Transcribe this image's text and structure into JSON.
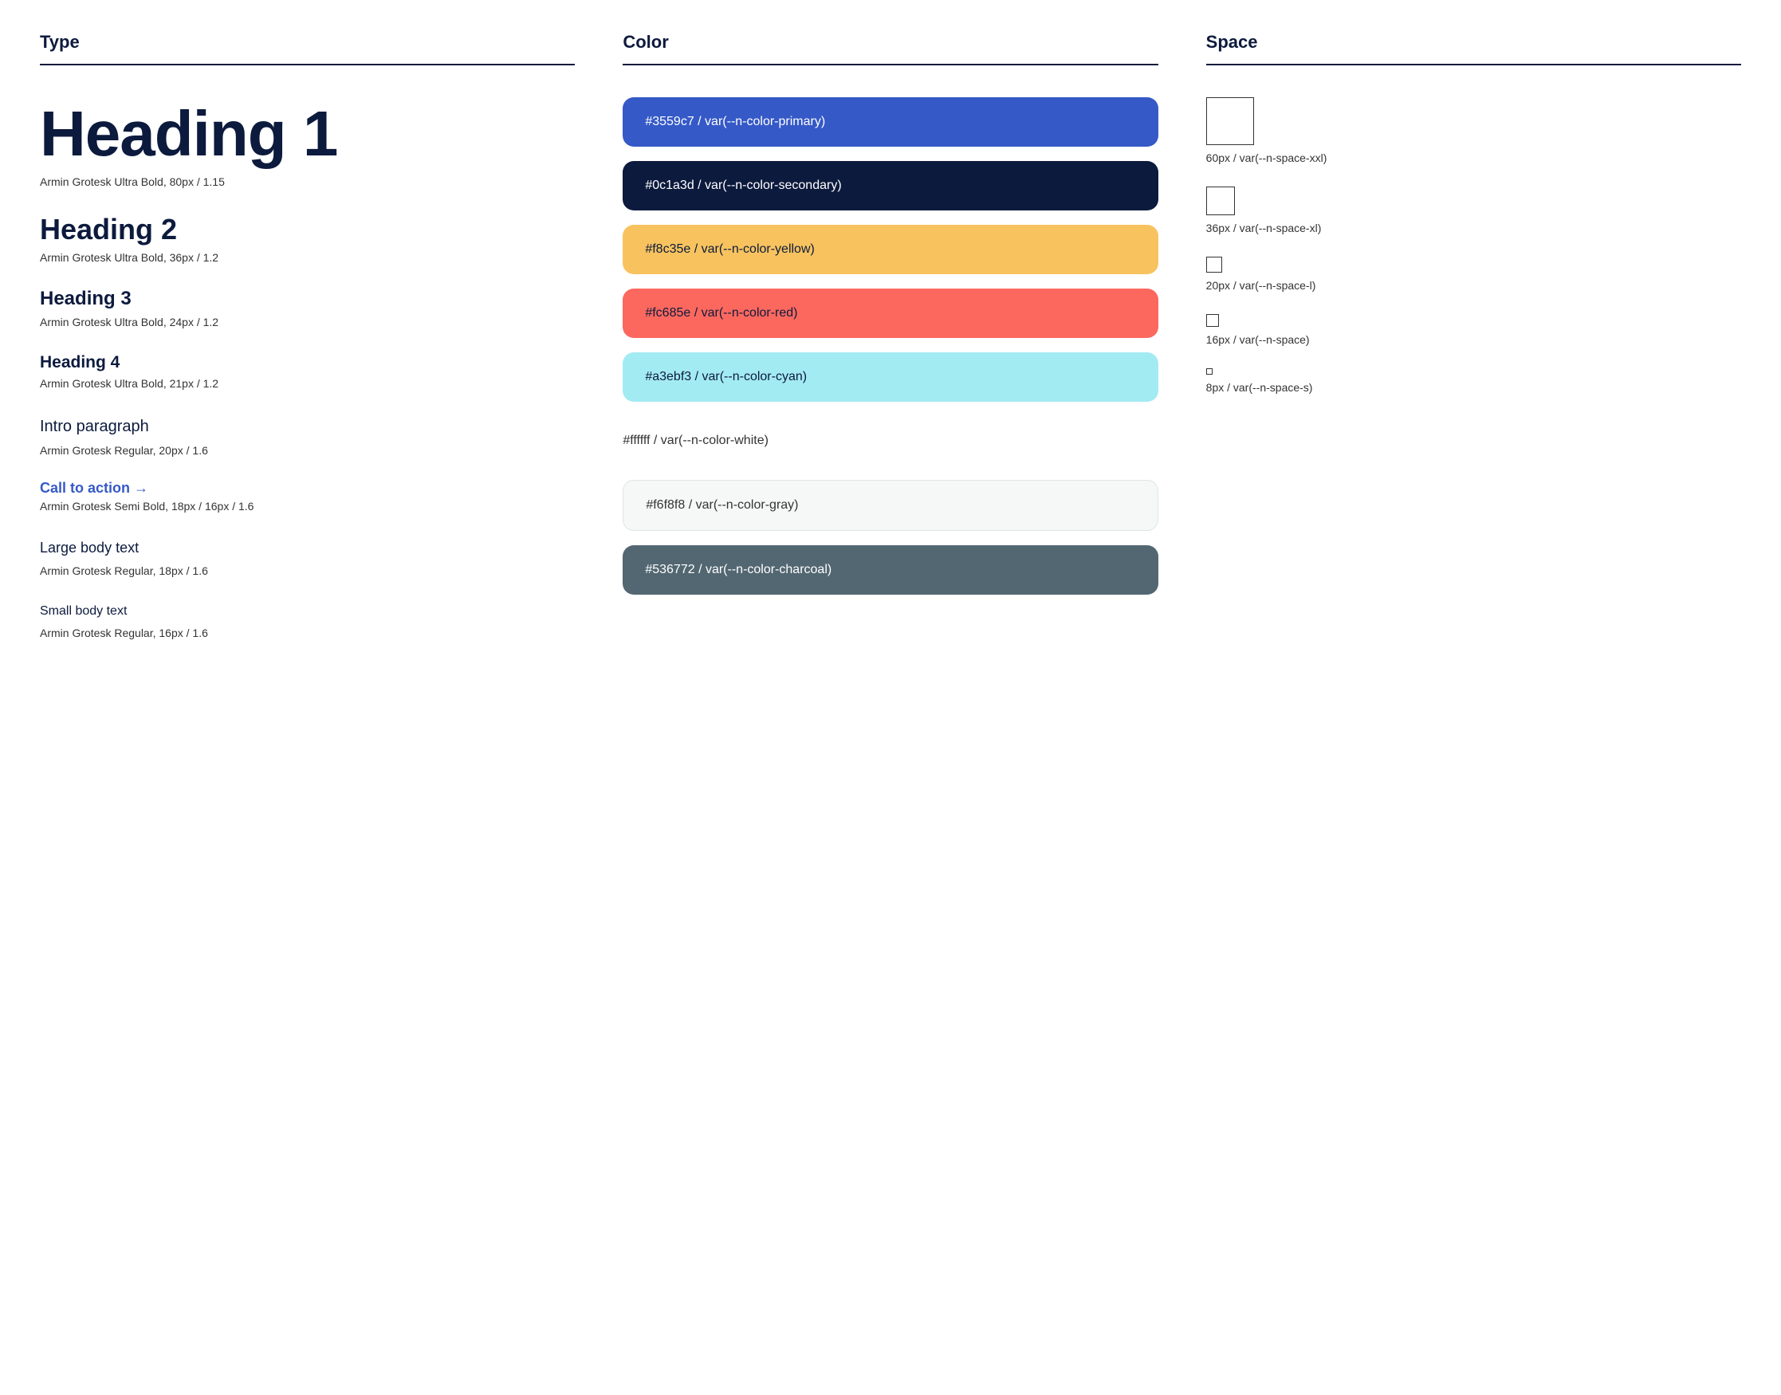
{
  "columns": {
    "type": {
      "header": "Type",
      "items": [
        {
          "name": "heading1",
          "sample": "Heading 1",
          "meta": "Armin Grotesk Ultra Bold, 80px / 1.15"
        },
        {
          "name": "heading2",
          "sample": "Heading 2",
          "meta": "Armin Grotesk Ultra Bold, 36px / 1.2"
        },
        {
          "name": "heading3",
          "sample": "Heading 3",
          "meta": "Armin Grotesk Ultra Bold, 24px / 1.2"
        },
        {
          "name": "heading4",
          "sample": "Heading 4",
          "meta": "Armin Grotesk Ultra Bold, 21px / 1.2"
        },
        {
          "name": "intro",
          "sample": "Intro paragraph",
          "meta": "Armin Grotesk Regular, 20px / 1.6"
        },
        {
          "name": "cta",
          "sample": "Call to action →",
          "meta": "Armin Grotesk Semi Bold, 18px / 16px / 1.6"
        },
        {
          "name": "large-body",
          "sample": "Large body text",
          "meta": "Armin Grotesk Regular, 18px / 1.6"
        },
        {
          "name": "small-body",
          "sample": "Small body text",
          "meta": "Armin Grotesk Regular, 16px / 1.6"
        }
      ]
    },
    "color": {
      "header": "Color",
      "items": [
        {
          "name": "primary",
          "label": "#3559c7 / var(--n-color-primary)",
          "class": "primary"
        },
        {
          "name": "secondary",
          "label": "#0c1a3d / var(--n-color-secondary)",
          "class": "secondary"
        },
        {
          "name": "yellow",
          "label": "#f8c35e / var(--n-color-yellow)",
          "class": "yellow"
        },
        {
          "name": "red",
          "label": "#fc685e / var(--n-color-red)",
          "class": "red"
        },
        {
          "name": "cyan",
          "label": "#a3ebf3 / var(--n-color-cyan)",
          "class": "cyan"
        },
        {
          "name": "white",
          "label": "#ffffff / var(--n-color-white)",
          "class": "white"
        },
        {
          "name": "gray",
          "label": "#f6f8f8 / var(--n-color-gray)",
          "class": "gray"
        },
        {
          "name": "charcoal",
          "label": "#536772 / var(--n-color-charcoal)",
          "class": "charcoal"
        }
      ]
    },
    "space": {
      "header": "Space",
      "items": [
        {
          "name": "xxl",
          "size": 60,
          "label": "60px / var(--n-space-xxl)"
        },
        {
          "name": "xl",
          "size": 36,
          "label": "36px / var(--n-space-xl)"
        },
        {
          "name": "l",
          "size": 20,
          "label": "20px / var(--n-space-l)"
        },
        {
          "name": "m",
          "size": 16,
          "label": "16px / var(--n-space)"
        },
        {
          "name": "s",
          "size": 8,
          "label": "8px / var(--n-space-s)"
        }
      ]
    }
  }
}
